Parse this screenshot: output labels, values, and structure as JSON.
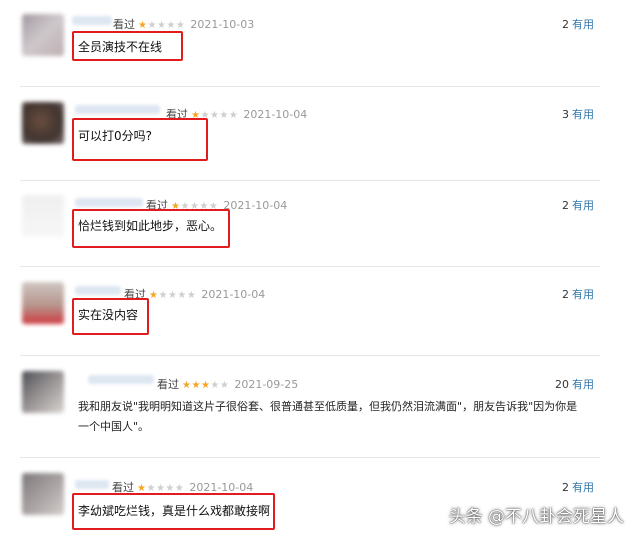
{
  "reviews": [
    {
      "seen": "看过",
      "stars_on": 1,
      "date": "2021-10-03",
      "votes": "2",
      "useful_label": "有用",
      "comment": "全员演技不在线"
    },
    {
      "seen": "看过",
      "stars_on": 1,
      "date": "2021-10-04",
      "votes": "3",
      "useful_label": "有用",
      "comment": "可以打0分吗?"
    },
    {
      "seen": "看过",
      "stars_on": 1,
      "date": "2021-10-04",
      "votes": "2",
      "useful_label": "有用",
      "comment": "恰烂钱到如此地步，恶心。"
    },
    {
      "seen": "看过",
      "stars_on": 1,
      "date": "2021-10-04",
      "votes": "2",
      "useful_label": "有用",
      "comment": "实在没内容"
    },
    {
      "seen": "看过",
      "stars_on": 3,
      "date": "2021-09-25",
      "votes": "20",
      "useful_label": "有用",
      "comment": "我和朋友说\"我明明知道这片子很俗套、很普通甚至低质量，但我仍然泪流满面\"，朋友告诉我\"因为你是一个中国人\"。"
    },
    {
      "seen": "看过",
      "stars_on": 1,
      "date": "2021-10-04",
      "votes": "2",
      "useful_label": "有用",
      "comment": "李幼斌吃烂钱，真是什么戏都敢接啊"
    }
  ],
  "watermark": "头条 @不八卦会死星人",
  "colors": {
    "highlight": "#e21c1c",
    "star": "#f5a623",
    "link": "#3377aa"
  },
  "icons": {
    "star": "star-icon"
  }
}
